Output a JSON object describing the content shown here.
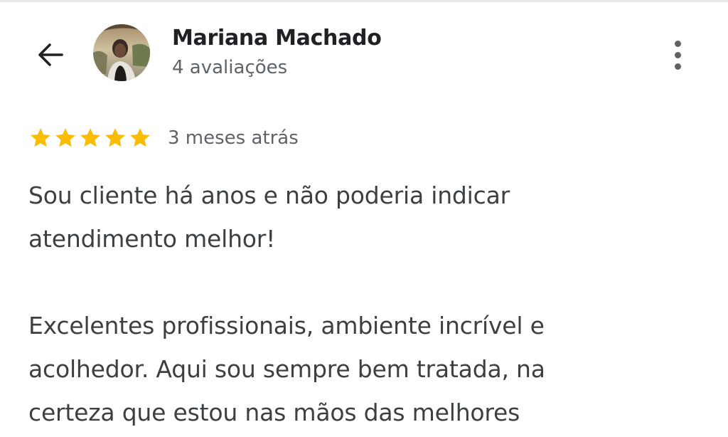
{
  "header": {
    "back_icon": "arrow-back-icon",
    "reviewer_name": "Mariana Machado",
    "review_count": "4 avaliações",
    "more_icon": "more-vert-icon"
  },
  "review": {
    "rating": 5,
    "rating_max": 5,
    "star_color": "#fbbc04",
    "date": "3 meses atrás",
    "lines": [
      "Sou cliente há anos e não poderia indicar",
      "atendimento melhor!",
      "",
      "Excelentes profissionais, ambiente incrível e",
      "acolhedor. Aqui sou sempre bem tratada, na",
      "certeza que estou nas mãos das melhores"
    ]
  }
}
